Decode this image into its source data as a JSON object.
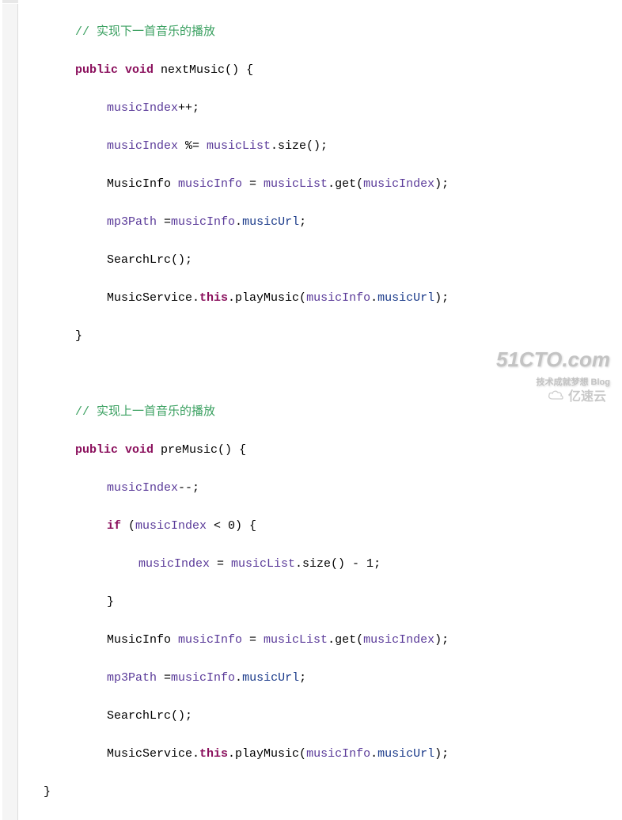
{
  "code": {
    "comment1": "// 实现下一首音乐的播放",
    "nextMusic": {
      "decl_public": "public",
      "decl_void": "void",
      "decl_name": " nextMusic() {",
      "l1_a": "musicIndex",
      "l1_b": "++;",
      "l2_a": "musicIndex",
      "l2_b": " %= ",
      "l2_c": "musicList",
      "l2_d": ".size();",
      "l3_a": "MusicInfo ",
      "l3_b": "musicInfo",
      "l3_c": " = ",
      "l3_d": "musicList",
      "l3_e": ".get(",
      "l3_f": "musicIndex",
      "l3_g": ");",
      "l4_a": "mp3Path",
      "l4_b": " =",
      "l4_c": "musicInfo",
      "l4_d": ".",
      "l4_e": "musicUrl",
      "l4_f": ";",
      "l5": "SearchLrc();",
      "l6_a": "MusicService.",
      "l6_b": "this",
      "l6_c": ".playMusic(",
      "l6_d": "musicInfo",
      "l6_e": ".",
      "l6_f": "musicUrl",
      "l6_g": ");",
      "close": "}"
    },
    "comment2": "// 实现上一首音乐的播放",
    "preMusic": {
      "decl_public": "public",
      "decl_void": "void",
      "decl_name": " preMusic() {",
      "l1_a": "musicIndex",
      "l1_b": "--;",
      "l2_if": "if",
      "l2_a": " (",
      "l2_b": "musicIndex",
      "l2_c": " < 0) {",
      "l3_a": "musicIndex",
      "l3_b": " = ",
      "l3_c": "musicList",
      "l3_d": ".size() - 1;",
      "l4": "}",
      "l5_a": "MusicInfo ",
      "l5_b": "musicInfo",
      "l5_c": " = ",
      "l5_d": "musicList",
      "l5_e": ".get(",
      "l5_f": "musicIndex",
      "l5_g": ");",
      "l6_a": "mp3Path",
      "l6_b": " =",
      "l6_c": "musicInfo",
      "l6_d": ".",
      "l6_e": "musicUrl",
      "l6_f": ";",
      "l7": "SearchLrc();",
      "l8_a": "MusicService.",
      "l8_b": "this",
      "l8_c": ".playMusic(",
      "l8_d": "musicInfo",
      "l8_e": ".",
      "l8_f": "musicUrl",
      "l8_g": ");",
      "close": "}"
    }
  },
  "watermarks": {
    "w1_main": "51CTO.com",
    "w1_sub": "技术成就梦想  Blog",
    "w2": "亿速云"
  }
}
